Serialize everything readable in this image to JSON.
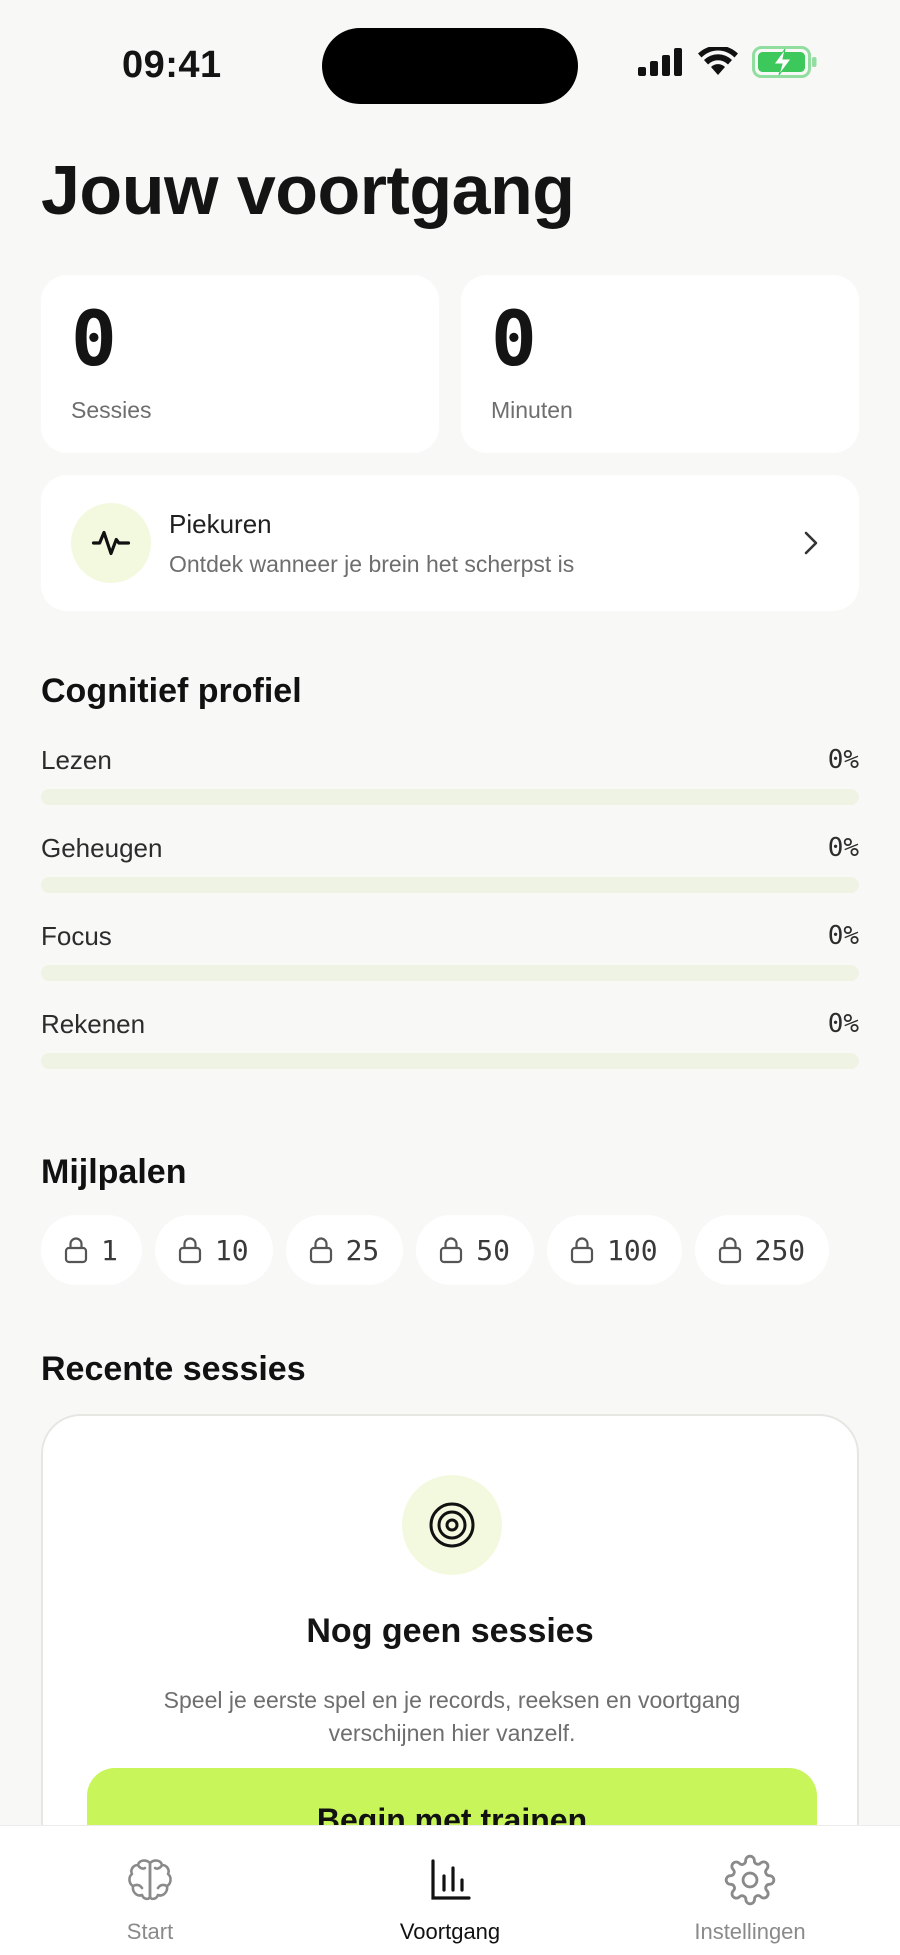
{
  "status_bar": {
    "time": "09:41"
  },
  "page": {
    "title": "Jouw voortgang"
  },
  "stats": [
    {
      "value": "0",
      "label": "Sessies"
    },
    {
      "value": "0",
      "label": "Minuten"
    }
  ],
  "peak": {
    "title": "Piekuren",
    "subtitle": "Ontdek wanneer je brein het scherpst is",
    "icon": "activity-icon"
  },
  "profile": {
    "title": "Cognitief profiel",
    "items": [
      {
        "name": "Lezen",
        "percent_label": "0%",
        "value": 0
      },
      {
        "name": "Geheugen",
        "percent_label": "0%",
        "value": 0
      },
      {
        "name": "Focus",
        "percent_label": "0%",
        "value": 0
      },
      {
        "name": "Rekenen",
        "percent_label": "0%",
        "value": 0
      }
    ]
  },
  "milestones": {
    "title": "Mijlpalen",
    "items": [
      "1",
      "10",
      "25",
      "50",
      "100",
      "250"
    ]
  },
  "recent": {
    "title": "Recente sessies",
    "empty_title": "Nog geen sessies",
    "empty_text": "Speel je eerste spel en je records, reeksen en voortgang verschijnen hier vanzelf.",
    "cta": "Begin met trainen"
  },
  "tabs": [
    {
      "label": "Start",
      "icon": "brain-icon",
      "active": false
    },
    {
      "label": "Voortgang",
      "icon": "bar-chart-icon",
      "active": true
    },
    {
      "label": "Instellingen",
      "icon": "gear-icon",
      "active": false
    }
  ],
  "colors": {
    "accent": "#c8f55a",
    "accent_soft": "#f3f9df",
    "battery": "#3cc85a"
  }
}
